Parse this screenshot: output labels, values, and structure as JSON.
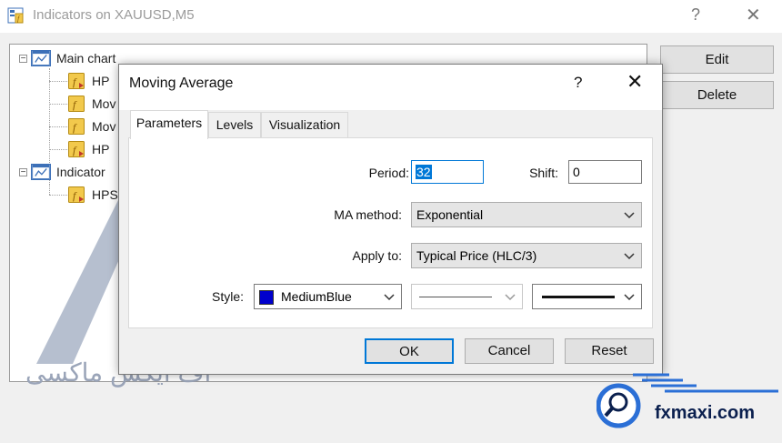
{
  "outer_window": {
    "title": "Indicators on XAUUSD,M5",
    "help_symbol": "?",
    "close_symbol": "✕",
    "buttons": {
      "edit": "Edit",
      "delete": "Delete"
    },
    "tree": {
      "items": [
        {
          "label": "Main chart",
          "type": "chart"
        },
        {
          "label": "HP",
          "type": "indicator"
        },
        {
          "label": "Mov",
          "type": "indicator"
        },
        {
          "label": "Mov",
          "type": "indicator"
        },
        {
          "label": "HP",
          "type": "indicator"
        },
        {
          "label": "Indicator",
          "type": "chart"
        },
        {
          "label": "HPS",
          "type": "indicator"
        }
      ],
      "expander_symbol": "−"
    }
  },
  "dialog": {
    "title": "Moving Average",
    "help_symbol": "?",
    "close_symbol": "✕",
    "tabs": [
      {
        "label": "Parameters",
        "active": true
      },
      {
        "label": "Levels",
        "active": false
      },
      {
        "label": "Visualization",
        "active": false
      }
    ],
    "params": {
      "period_label": "Period:",
      "period_value": "32",
      "shift_label": "Shift:",
      "shift_value": "0",
      "ma_method_label": "MA method:",
      "ma_method_value": "Exponential",
      "apply_to_label": "Apply to:",
      "apply_to_value": "Typical Price (HLC/3)",
      "style_label": "Style:",
      "color_name": "MediumBlue",
      "color_hex": "#0000cd"
    },
    "footer": {
      "ok": "OK",
      "cancel": "Cancel",
      "reset": "Reset"
    }
  },
  "watermark": {
    "arabic_text": "اف ایکس ماکسی",
    "brand": "fxmaxi.com"
  },
  "colors": {
    "accent": "#0078d7",
    "tree_icon_blue": "#3c70b8",
    "fx_icon_yellow": "#f2c94c",
    "brand_navy": "#0a1f4e"
  }
}
